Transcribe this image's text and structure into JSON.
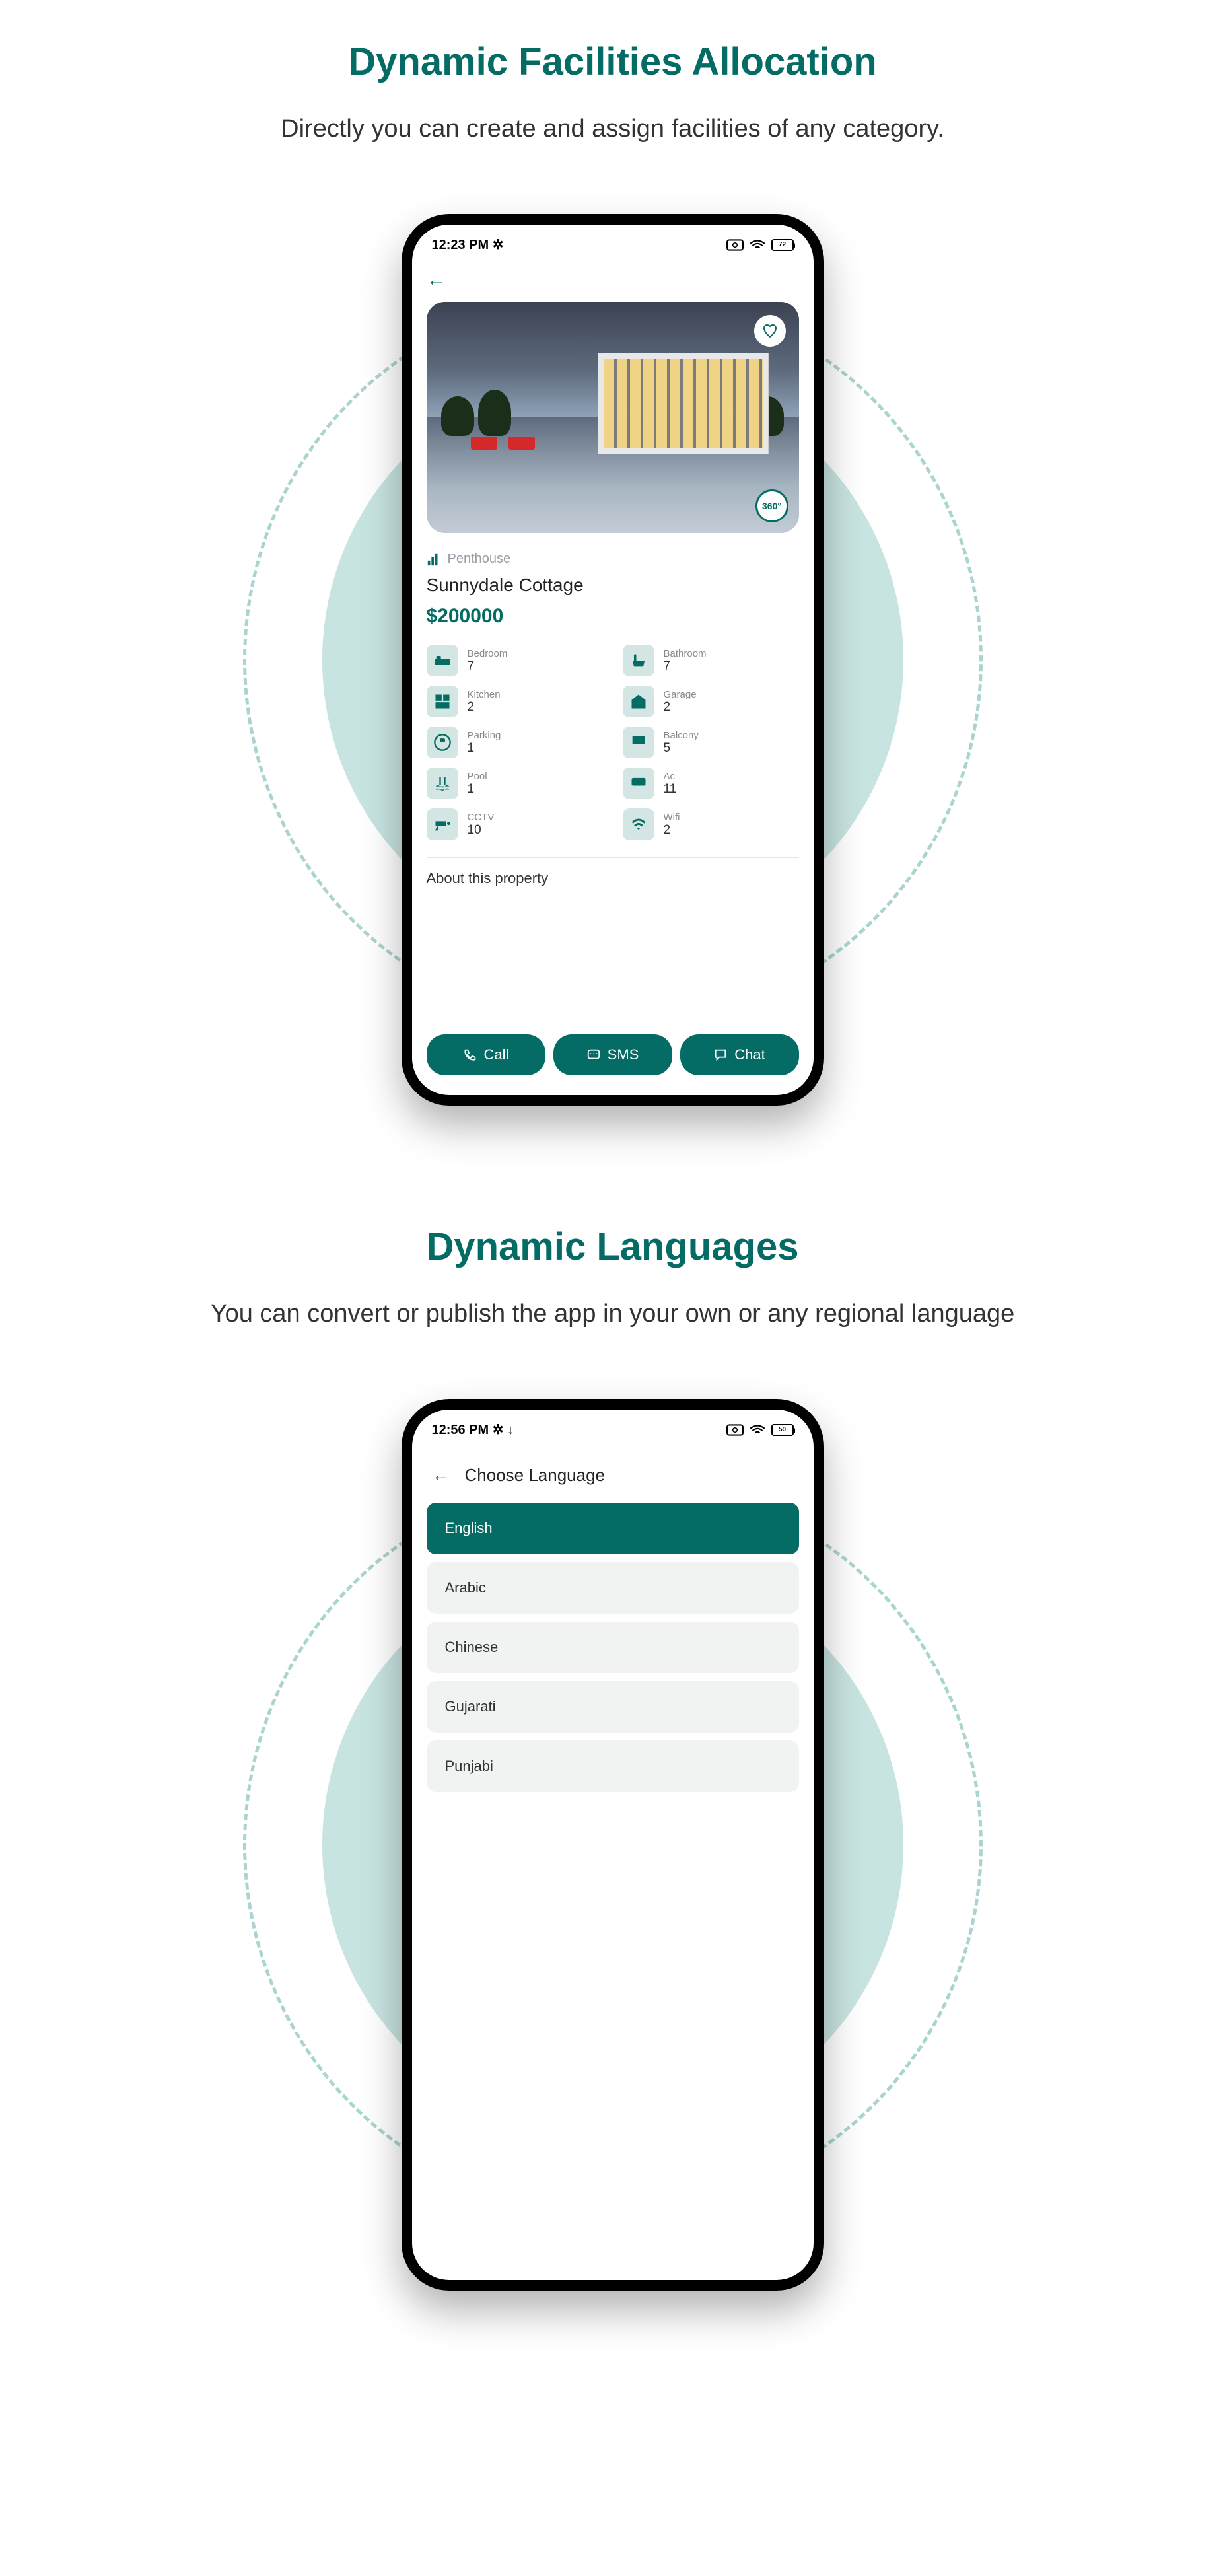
{
  "section1": {
    "title": "Dynamic Facilities Allocation",
    "subtitle": "Directly you can create and assign facilities of any category."
  },
  "section2": {
    "title": "Dynamic Languages",
    "subtitle": "You can convert or publish the app in your own or any regional language"
  },
  "phone1": {
    "status_time": "12:23 PM ✲",
    "battery": "72",
    "category": "Penthouse",
    "property_name": "Sunnydale Cottage",
    "price": "$200000",
    "badge360": "360°",
    "facilities": [
      {
        "label": "Bedroom",
        "value": "7"
      },
      {
        "label": "Bathroom",
        "value": "7"
      },
      {
        "label": "Kitchen",
        "value": "2"
      },
      {
        "label": "Garage",
        "value": "2"
      },
      {
        "label": "Parking",
        "value": "1"
      },
      {
        "label": "Balcony",
        "value": "5"
      },
      {
        "label": "Pool",
        "value": "1"
      },
      {
        "label": "Ac",
        "value": "11"
      },
      {
        "label": "CCTV",
        "value": "10"
      },
      {
        "label": "Wifi",
        "value": "2"
      }
    ],
    "about_label": "About this property",
    "actions": {
      "call": "Call",
      "sms": "SMS",
      "chat": "Chat"
    }
  },
  "phone2": {
    "status_time": "12:56 PM ✲ ↓",
    "battery": "50",
    "header": "Choose Language",
    "languages": [
      "English",
      "Arabic",
      "Chinese",
      "Gujarati",
      "Punjabi"
    ],
    "selected_index": 0
  }
}
